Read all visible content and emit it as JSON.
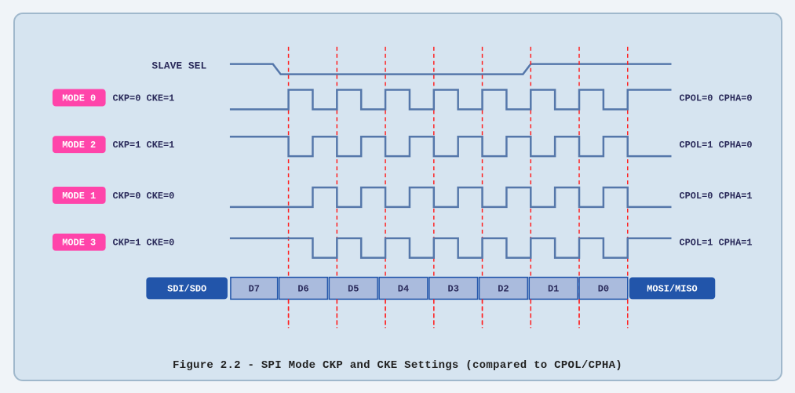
{
  "caption": "Figure 2.2 - SPI Mode CKP and CKE Settings (compared to CPOL/CPHA)",
  "diagram": {
    "slave_sel_label": "SLAVE SEL",
    "modes": [
      {
        "id": "MODE 0",
        "params": "CKP=0  CKE=1",
        "right": "CPOL=0  CPHA=0"
      },
      {
        "id": "MODE 2",
        "params": "CKP=1  CKE=1",
        "right": "CPOL=1  CPHA=0"
      },
      {
        "id": "MODE 1",
        "params": "CKP=0  CKE=0",
        "right": "CPOL=0  CPHA=1"
      },
      {
        "id": "MODE 3",
        "params": "CKP=1  CKE=0",
        "right": "CPOL=1  CPHA=1"
      }
    ],
    "data_labels": [
      "SDI/SDO",
      "D7",
      "D6",
      "D5",
      "D4",
      "D3",
      "D2",
      "D1",
      "D0",
      "MOSI/MISO"
    ],
    "mode_color": "#ff44aa",
    "mode_bg": "#ff44aa",
    "waveform_color": "#5577aa",
    "dashed_color": "#ff2222",
    "data_bar_bg": "#2255aa",
    "data_bar_color": "#aabbdd"
  }
}
